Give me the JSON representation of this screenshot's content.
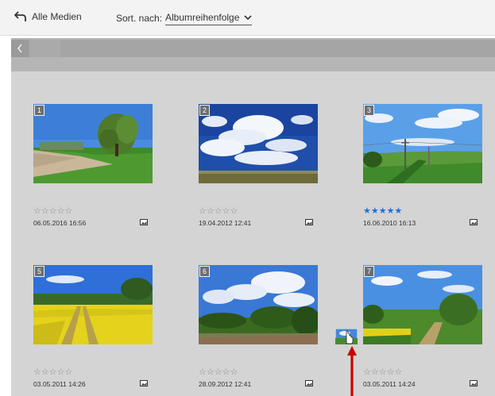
{
  "header": {
    "back_label": "Alle Medien",
    "sort_label": "Sort. nach:",
    "sort_value": "Albumreihenfolge"
  },
  "colors": {
    "accent_star": "#1e6fd9",
    "arrow": "#cc0000",
    "grid_bg": "#d4d4d4"
  },
  "items": [
    {
      "number": "1",
      "stars": "☆☆☆☆☆",
      "rating": 0,
      "date": "06.05.2016 16:56",
      "type_icon": "photo-icon"
    },
    {
      "number": "2",
      "stars": "☆☆☆☆☆",
      "rating": 0,
      "date": "19.04.2012 12:41",
      "type_icon": "photo-icon"
    },
    {
      "number": "3",
      "stars": "★★★★★",
      "rating": 5,
      "date": "16.06.2010 16:13",
      "type_icon": "photo-icon"
    },
    {
      "number": "5",
      "stars": "☆☆☆☆☆",
      "rating": 0,
      "date": "03.05.2011 14:26",
      "type_icon": "photo-icon"
    },
    {
      "number": "6",
      "stars": "☆☆☆☆☆",
      "rating": 0,
      "date": "28.09.2012 12:41",
      "type_icon": "photo-icon"
    },
    {
      "number": "7",
      "stars": "☆☆☆☆☆",
      "rating": 0,
      "date": "03.05.2011 14:24",
      "type_icon": "photo-icon"
    }
  ]
}
